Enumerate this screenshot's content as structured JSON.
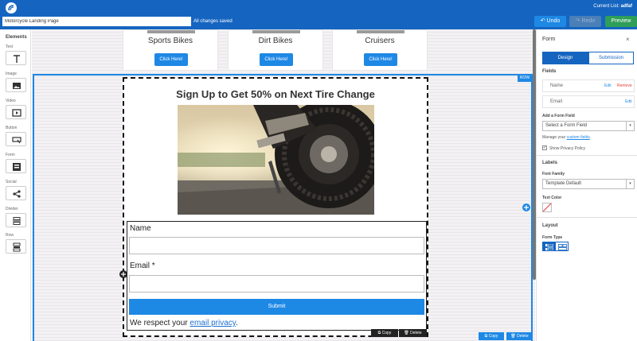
{
  "topbar": {
    "current_list_label": "Current List:",
    "current_list_value": "adfaf",
    "page_title_value": "Motorcycle Landing Page",
    "save_status": "All changes saved",
    "undo_label": "Undo",
    "redo_label": "Redo",
    "preview_label": "Preview"
  },
  "sidebar": {
    "title": "Elements",
    "items": [
      {
        "label": "Text",
        "icon": "text-icon"
      },
      {
        "label": "Image",
        "icon": "image-icon"
      },
      {
        "label": "Video",
        "icon": "video-icon"
      },
      {
        "label": "Button",
        "icon": "button-icon"
      },
      {
        "label": "Form",
        "icon": "form-icon"
      },
      {
        "label": "Social",
        "icon": "share-icon"
      },
      {
        "label": "Divider",
        "icon": "divider-icon"
      },
      {
        "label": "Row",
        "icon": "row-icon"
      }
    ]
  },
  "canvas": {
    "categories": [
      {
        "name": "Sports Bikes",
        "button": "Click Here!"
      },
      {
        "name": "Dirt Bikes",
        "button": "Click Here!"
      },
      {
        "name": "Cruisers",
        "button": "Click Here!"
      }
    ],
    "row_badge": "ROW",
    "row_copy": "Copy",
    "row_delete": "Delete",
    "form": {
      "heading": "Sign Up to Get 50% on Next Tire Change",
      "name_label": "Name",
      "email_label": "Email *",
      "submit_label": "Submit",
      "privacy_prefix": "We respect your ",
      "privacy_link": "email privacy",
      "privacy_suffix": "."
    },
    "section_copy": "Copy",
    "section_delete": "Delete"
  },
  "panel": {
    "title": "Form",
    "close": "×",
    "tab_design": "Design",
    "tab_submission": "Submission",
    "fields_heading": "Fields",
    "fields": [
      {
        "name": "Name",
        "edit": "Edit",
        "remove": "Remove"
      },
      {
        "name": "Email",
        "edit": "Edit"
      }
    ],
    "add_field_label": "Add a Form Field",
    "add_field_value": "Select a Form Field",
    "manage_prefix": "Manage your ",
    "manage_link": "custom fields",
    "manage_suffix": ".",
    "privacy_checkbox": "Show Privacy Policy",
    "privacy_checked": true,
    "labels_heading": "Labels",
    "font_family_label": "Font Family",
    "font_family_value": "Template Default",
    "text_color_label": "Text Color",
    "layout_heading": "Layout",
    "form_type_label": "Form Type"
  },
  "colors": {
    "topbar": "#1565c0",
    "accent": "#1e88e5",
    "preview": "#2e9e58"
  }
}
